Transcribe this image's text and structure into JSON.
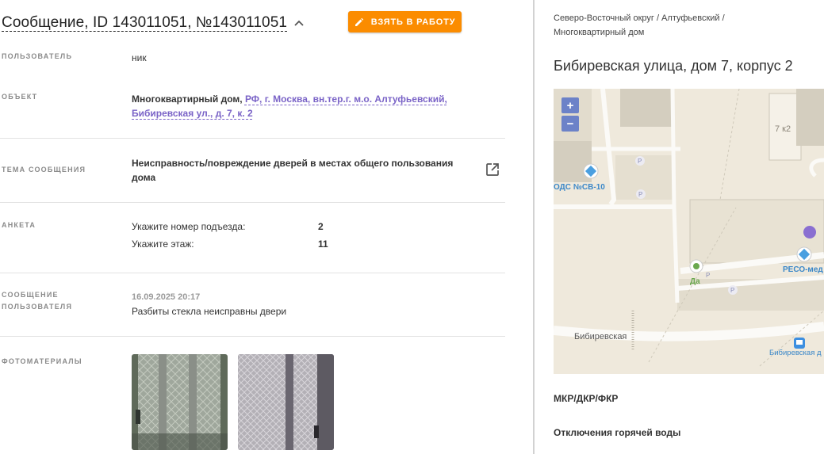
{
  "header": {
    "title": "Сообщение, ID 143011051, №143011051",
    "take_button_label": "ВЗЯТЬ В РАБОТУ"
  },
  "fields": {
    "user": {
      "label": "ПОЛЬЗОВАТЕЛЬ",
      "value": "ник"
    },
    "object": {
      "label": "ОБЪЕКТ",
      "type_text": "Многоквартирный дом,",
      "address_link": "РФ, г. Москва, вн.тер.г. м.о. Алтуфьевский, Бибиревская ул., д. 7, к. 2"
    },
    "topic": {
      "label": "ТЕМА СООБЩЕНИЯ",
      "value": "Неисправность/повреждение дверей в местах общего пользования дома"
    },
    "survey": {
      "label": "АНКЕТА",
      "items": [
        {
          "question": "Укажите номер подъезда:",
          "answer": "2"
        },
        {
          "question": "Укажите этаж:",
          "answer": "11"
        }
      ]
    },
    "user_message": {
      "label_line1": "СООБЩЕНИЕ",
      "label_line2": "ПОЛЬЗОВАТЕЛЯ",
      "date": "16.09.2025 20:17",
      "text": "Разбиты стекла неисправны двери"
    },
    "photos": {
      "label": "ФОТОМАТЕРИАЛЫ",
      "count": 2
    }
  },
  "right": {
    "breadcrumb_line1": "Северо-Восточный округ / Алтуфьевский /",
    "breadcrumb_line2": "Многоквартирный дом",
    "address_title": "Бибиревская улица, дом 7, корпус 2",
    "map": {
      "zoom_in": "+",
      "zoom_out": "−",
      "label_building": "7 к2",
      "label_ods": "ОДС №СВ-10",
      "label_reso": "РЕСО-мед",
      "label_street": "Бибиревская",
      "label_stop": "Бибиревская д",
      "label_shop": "Да",
      "parking": "P"
    },
    "sections": [
      "МКР/ДКР/ФКР",
      "Отключения горячей воды"
    ]
  },
  "colors": {
    "accent_orange": "#fb8c00",
    "link_purple": "#7a63c7",
    "zoom_blue": "#6c82c8",
    "marker_purple": "#8a6fd1"
  }
}
